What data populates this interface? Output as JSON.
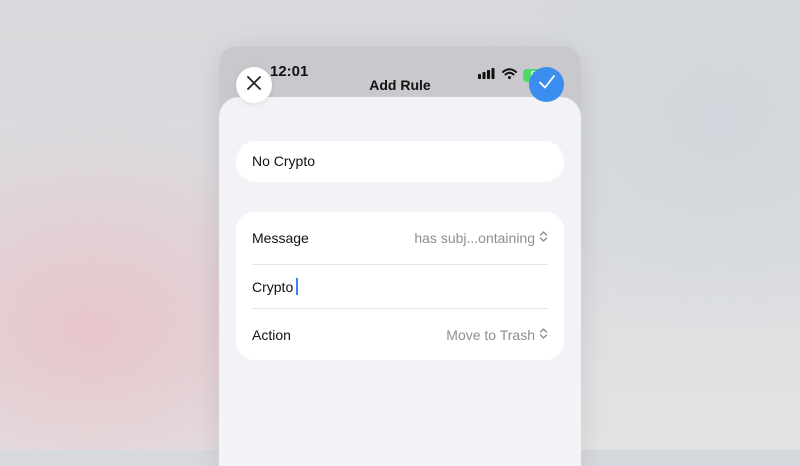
{
  "status_bar": {
    "time": "12:01",
    "battery": "84"
  },
  "header": {
    "title": "Add Rule"
  },
  "rule": {
    "name": "No Crypto",
    "condition_label": "Message",
    "condition_value": "has subj...ontaining",
    "keyword": "Crypto",
    "action_label": "Action",
    "action_value": "Move to Trash"
  },
  "icons": {
    "close": "close-icon",
    "confirm": "checkmark-icon",
    "signal": "cellular-signal-icon",
    "wifi": "wifi-icon",
    "battery": "battery-icon",
    "chevron": "chevron-up-down-icon"
  },
  "colors": {
    "accent": "#3b8df0",
    "battery": "#4cd964",
    "sheet_bg": "#f2f2f7"
  }
}
